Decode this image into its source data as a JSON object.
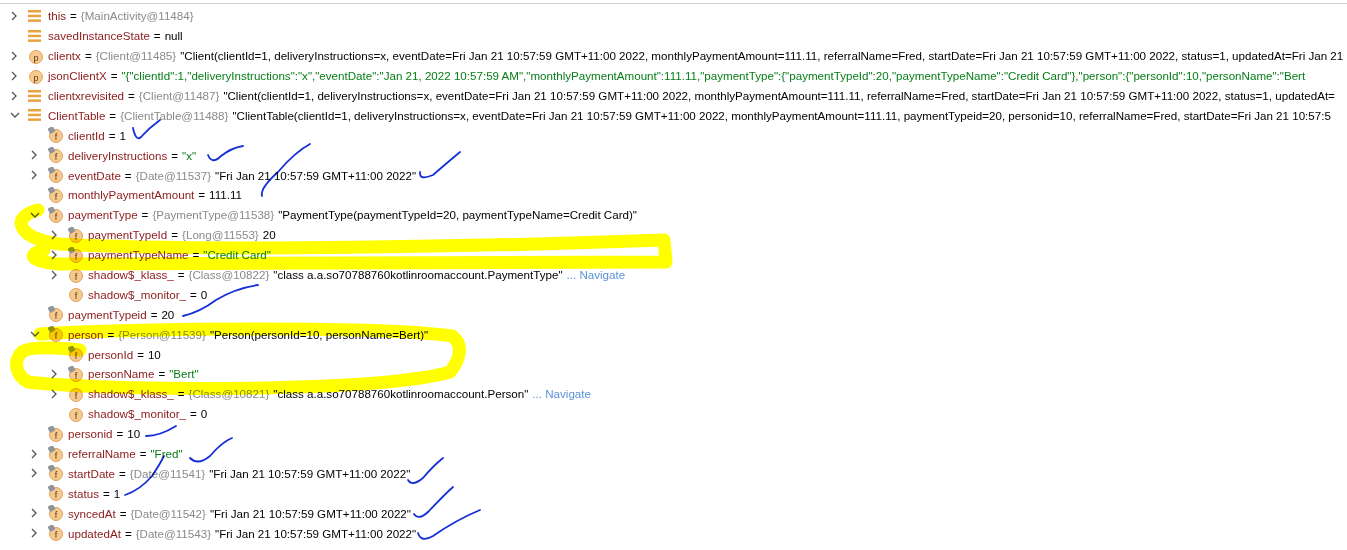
{
  "variables": [
    {
      "name": "this",
      "eq": "=",
      "ref": "{MainActivity@11484}",
      "kind": "list",
      "expanded": false
    },
    {
      "name": "savedInstanceState",
      "eq": "=",
      "value": "null",
      "kind": "list"
    },
    {
      "name": "clientx",
      "eq": "=",
      "ref": "{Client@11485}",
      "value": "\"Client(clientId=1, deliveryInstructions=x, eventDate=Fri Jan 21 10:57:59 GMT+11:00 2022, monthlyPaymentAmount=111.11, referralName=Fred, startDate=Fri Jan 21 10:57:59 GMT+11:00 2022, status=1, updatedAt=Fri Jan 21",
      "kind": "p",
      "locked": false,
      "expanded": false
    },
    {
      "name": "jsonClientX",
      "eq": "=",
      "string": "\"{\"clientId\":1,\"deliveryInstructions\":\"x\",\"eventDate\":\"Jan 21, 2022 10:57:59 AM\",\"monthlyPaymentAmount\":111.11,\"paymentType\":{\"paymentTypeId\":20,\"paymentTypeName\":\"Credit Card\"},\"person\":{\"personId\":10,\"personName\":\"Bert",
      "kind": "p",
      "locked": false,
      "expanded": false
    },
    {
      "name": "clientxrevisited",
      "eq": "=",
      "ref": "{Client@11487}",
      "value": "\"Client(clientId=1, deliveryInstructions=x, eventDate=Fri Jan 21 10:57:59 GMT+11:00 2022, monthlyPaymentAmount=111.11, referralName=Fred, startDate=Fri Jan 21 10:57:59 GMT+11:00 2022, status=1, updatedAt=",
      "kind": "list",
      "expanded": false
    },
    {
      "name": "ClientTable",
      "eq": "=",
      "ref": "{ClientTable@11488}",
      "value": "\"ClientTable(clientId=1, deliveryInstructions=x, eventDate=Fri Jan 21 10:57:59 GMT+11:00 2022, monthlyPaymentAmount=111.11, paymentTypeid=20, personid=10, referralName=Fred, startDate=Fri Jan 21 10:57:5",
      "kind": "list",
      "expanded": true,
      "children": [
        {
          "name": "clientId",
          "eq": "=",
          "value": "1",
          "kind": "f",
          "locked": true
        },
        {
          "name": "deliveryInstructions",
          "eq": "=",
          "string": "\"x\"",
          "kind": "f",
          "locked": true,
          "expanded": false
        },
        {
          "name": "eventDate",
          "eq": "=",
          "ref": "{Date@11537}",
          "value": "\"Fri Jan 21 10:57:59 GMT+11:00 2022\"",
          "kind": "f",
          "locked": true,
          "expanded": false
        },
        {
          "name": "monthlyPaymentAmount",
          "eq": "=",
          "value": "111.11",
          "kind": "f",
          "locked": true
        },
        {
          "name": "paymentType",
          "eq": "=",
          "ref": "{PaymentType@11538}",
          "value": "\"PaymentType(paymentTypeId=20, paymentTypeName=Credit Card)\"",
          "kind": "f",
          "locked": true,
          "expanded": true,
          "children": [
            {
              "name": "paymentTypeId",
              "eq": "=",
              "ref": "{Long@11553}",
              "value": "20",
              "kind": "f",
              "locked": true,
              "expanded": false
            },
            {
              "name": "paymentTypeName",
              "eq": "=",
              "string": "\"Credit Card\"",
              "kind": "f",
              "locked": true,
              "expanded": false
            },
            {
              "name": "shadow$_klass_",
              "eq": "=",
              "ref": "{Class@10822}",
              "value": "\"class a.a.so70788760kotlinroomaccount.PaymentType\"",
              "link": "... Navigate",
              "kind": "f",
              "locked": false,
              "expanded": false
            },
            {
              "name": "shadow$_monitor_",
              "eq": "=",
              "value": "0",
              "kind": "f",
              "locked": false
            }
          ]
        },
        {
          "name": "paymentTypeid",
          "eq": "=",
          "value": "20",
          "kind": "f",
          "locked": true
        },
        {
          "name": "person",
          "eq": "=",
          "ref": "{Person@11539}",
          "value": "\"Person(personId=10, personName=Bert)\"",
          "kind": "f",
          "locked": true,
          "expanded": true,
          "children": [
            {
              "name": "personId",
              "eq": "=",
              "value": "10",
              "kind": "f",
              "locked": true
            },
            {
              "name": "personName",
              "eq": "=",
              "string": "\"Bert\"",
              "kind": "f",
              "locked": true,
              "expanded": false
            },
            {
              "name": "shadow$_klass_",
              "eq": "=",
              "ref": "{Class@10821}",
              "value": "\"class a.a.so70788760kotlinroomaccount.Person\"",
              "link": "... Navigate",
              "kind": "f",
              "locked": false,
              "expanded": false
            },
            {
              "name": "shadow$_monitor_",
              "eq": "=",
              "value": "0",
              "kind": "f",
              "locked": false
            }
          ]
        },
        {
          "name": "personid",
          "eq": "=",
          "value": "10",
          "kind": "f",
          "locked": true
        },
        {
          "name": "referralName",
          "eq": "=",
          "string": "\"Fred\"",
          "kind": "f",
          "locked": true,
          "expanded": false
        },
        {
          "name": "startDate",
          "eq": "=",
          "ref": "{Date@11541}",
          "value": "\"Fri Jan 21 10:57:59 GMT+11:00 2022\"",
          "kind": "f",
          "locked": true,
          "expanded": false
        },
        {
          "name": "status",
          "eq": "=",
          "value": "1",
          "kind": "f",
          "locked": true
        },
        {
          "name": "syncedAt",
          "eq": "=",
          "ref": "{Date@11542}",
          "value": "\"Fri Jan 21 10:57:59 GMT+11:00 2022\"",
          "kind": "f",
          "locked": true,
          "expanded": false
        },
        {
          "name": "updatedAt",
          "eq": "=",
          "ref": "{Date@11543}",
          "value": "\"Fri Jan 21 10:57:59 GMT+11:00 2022\"",
          "kind": "f",
          "locked": true,
          "expanded": false
        }
      ]
    }
  ]
}
